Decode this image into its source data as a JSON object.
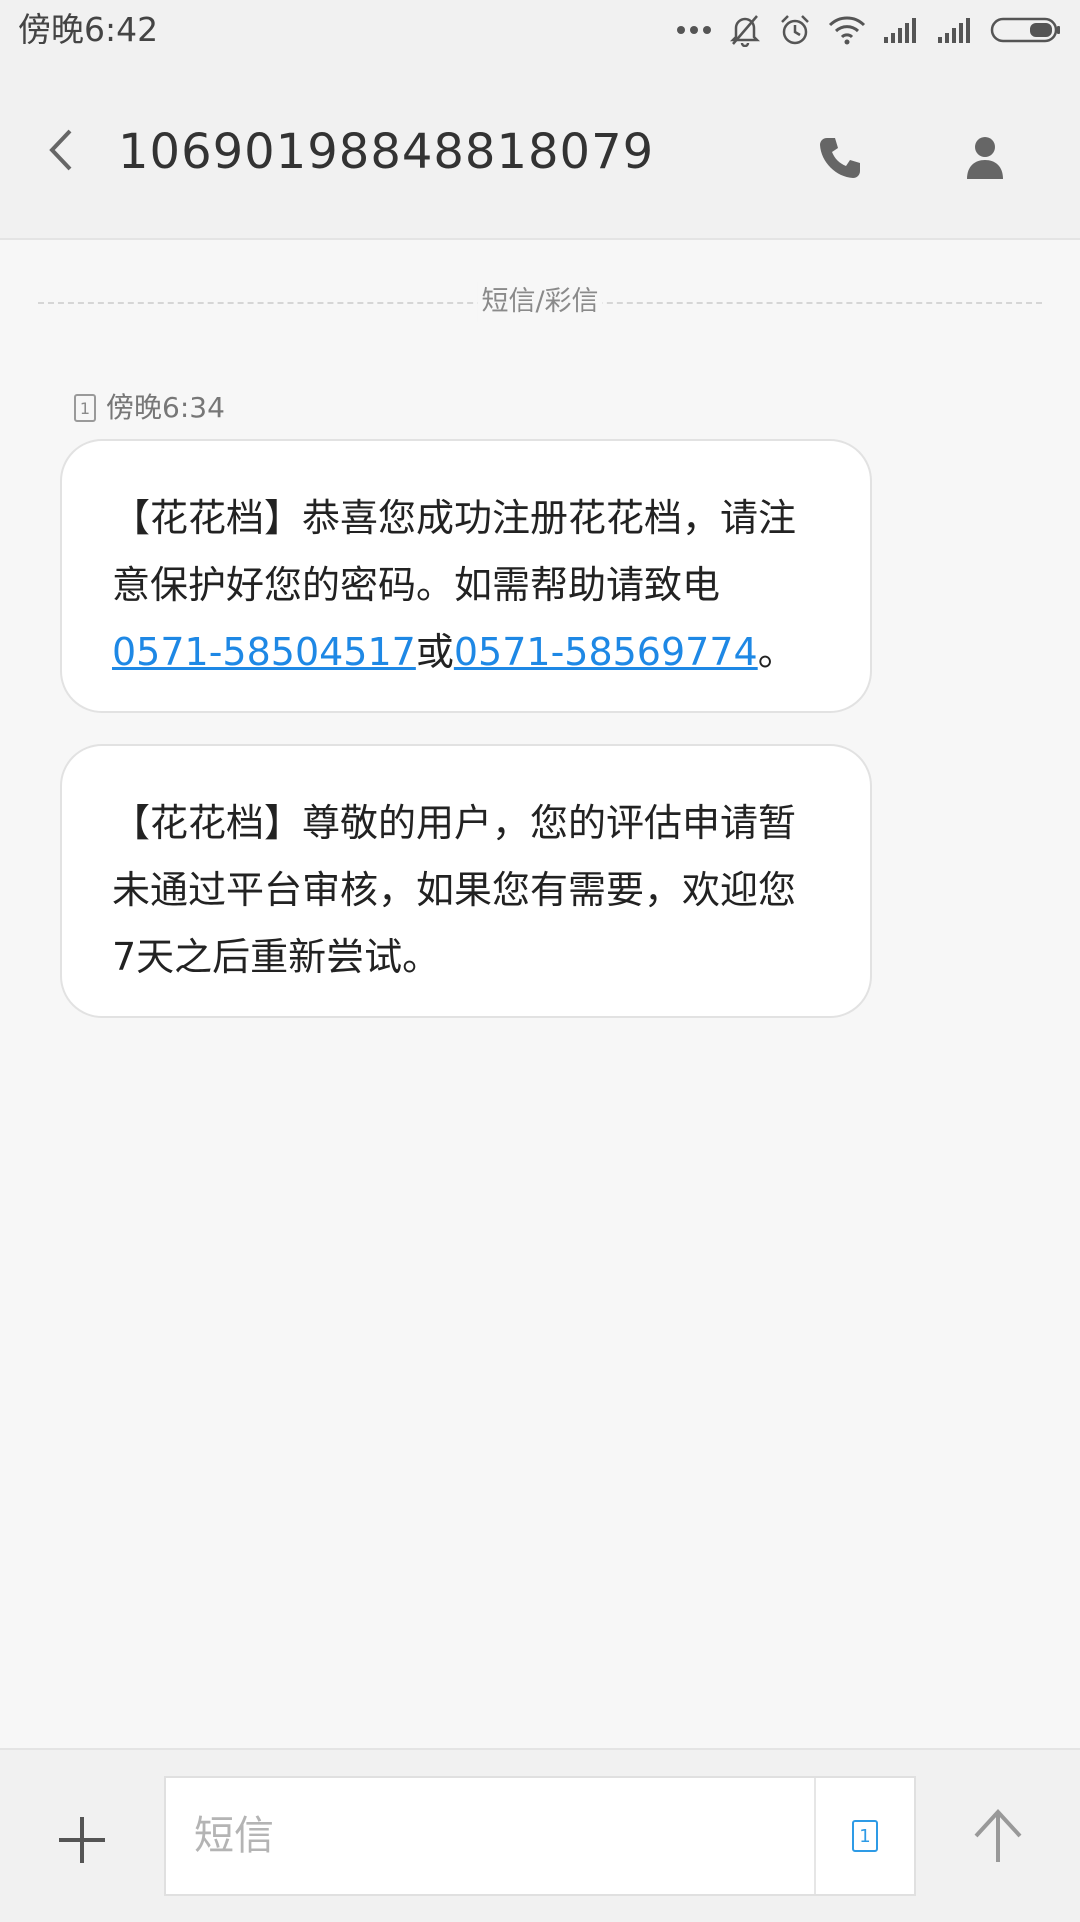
{
  "status_bar": {
    "time": "傍晚6:42",
    "icons": [
      "more-dots-icon",
      "bell-muted-icon",
      "alarm-icon",
      "wifi-icon",
      "signal-1-icon",
      "signal-2-icon",
      "battery-icon"
    ]
  },
  "header": {
    "title": "10690198848818079",
    "icons": [
      "back-arrow-icon",
      "phone-icon",
      "person-icon"
    ]
  },
  "conversation": {
    "divider_label": "短信/彩信",
    "meta": {
      "sim": "1",
      "time": "傍晚6:34"
    },
    "messages": [
      {
        "text_1": "【花花档】恭喜您成功注册花花档，请注意保护好您的密码。如需帮助请致电",
        "link_1": "0571-58504517",
        "text_2": "或",
        "link_2": "0571-58569774",
        "text_3": "。"
      },
      {
        "text": "【花花档】尊敬的用户，您的评估申请暂未通过平台审核，如果您有需要，欢迎您7天之后重新尝试。"
      }
    ]
  },
  "composer": {
    "placeholder": "短信",
    "value": "",
    "sim": "1",
    "icons": [
      "plus-icon",
      "sim-card-icon",
      "send-arrow-icon"
    ]
  },
  "colors": {
    "link": "#1e88e5",
    "accent": "#2e9be6",
    "background": "#f7f7f7",
    "bar": "#f1f1f1"
  }
}
